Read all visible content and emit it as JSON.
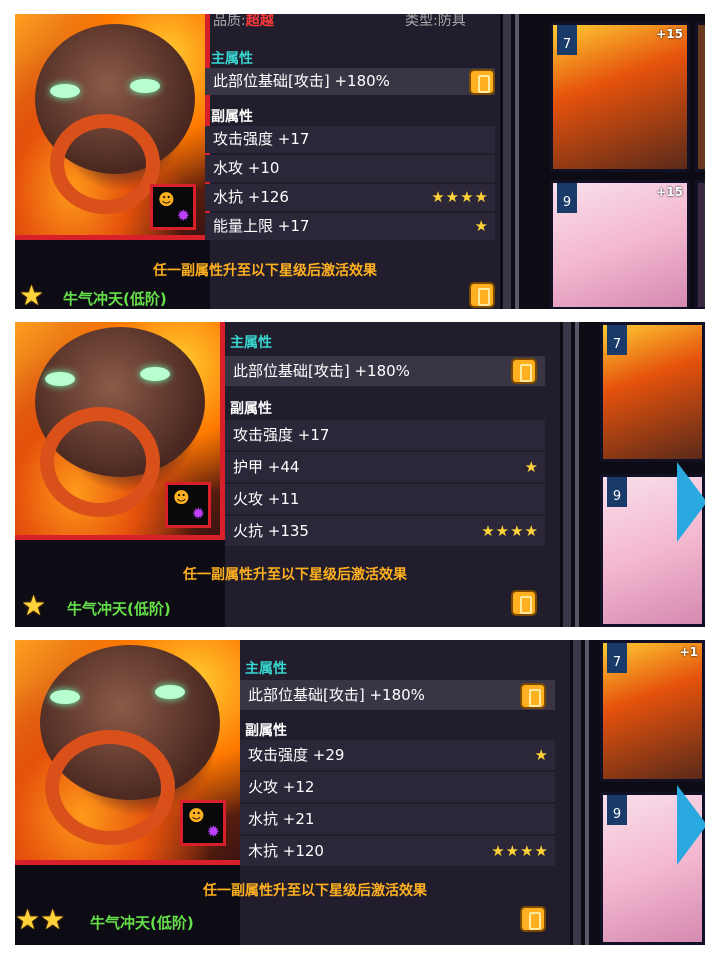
{
  "panels": [
    {
      "quality_label": "品质:",
      "quality_value": "超越",
      "type_label": "类型:",
      "type_value": "防具",
      "main_attr_title": "主属性",
      "main_attr": "此部位基础[攻击] +180%",
      "sub_attr_title": "副属性",
      "sub_attrs": [
        {
          "text": "攻击强度 +17",
          "stars": ""
        },
        {
          "text": "水攻 +10",
          "stars": ""
        },
        {
          "text": "水抗 +126",
          "stars": "★★★★"
        },
        {
          "text": "能量上限 +17",
          "stars": "★"
        }
      ],
      "hint": "任一副属性升至以下星级后激活效果",
      "set_name": "牛气冲天(低阶)",
      "set_stars": "★",
      "cards": [
        {
          "level": "7",
          "plus": "+15"
        },
        {
          "level": "9",
          "plus": "+15"
        }
      ]
    },
    {
      "main_attr_title": "主属性",
      "main_attr": "此部位基础[攻击] +180%",
      "sub_attr_title": "副属性",
      "sub_attrs": [
        {
          "text": "攻击强度 +17",
          "stars": ""
        },
        {
          "text": "护甲 +44",
          "stars": "★"
        },
        {
          "text": "火攻 +11",
          "stars": ""
        },
        {
          "text": "火抗 +135",
          "stars": "★★★★"
        }
      ],
      "hint": "任一副属性升至以下星级后激活效果",
      "set_name": "牛气冲天(低阶)",
      "set_stars": "★",
      "cards": [
        {
          "level": "7",
          "plus": ""
        },
        {
          "level": "9",
          "plus": ""
        }
      ]
    },
    {
      "main_attr_title": "主属性",
      "main_attr": "此部位基础[攻击] +180%",
      "sub_attr_title": "副属性",
      "sub_attrs": [
        {
          "text": "攻击强度 +29",
          "stars": "★"
        },
        {
          "text": "火攻 +12",
          "stars": ""
        },
        {
          "text": "水抗 +21",
          "stars": ""
        },
        {
          "text": "木抗 +120",
          "stars": "★★★★"
        }
      ],
      "hint": "任一副属性升至以下星级后激活效果",
      "set_name": "牛气冲天(低阶)",
      "set_stars": "★★",
      "cards": [
        {
          "level": "7",
          "plus": "+1"
        },
        {
          "level": "9",
          "plus": ""
        }
      ]
    }
  ],
  "colors": {
    "accent_cyan": "#39d6d0",
    "quality_red": "#ff3a3a",
    "hint_orange": "#ffb020",
    "set_green": "#66e04a",
    "star_gold": "#ffd23a"
  },
  "icons": [
    "lock-icon",
    "star-icon",
    "skull-icon",
    "gear-icon",
    "scroll-right-arrow-icon"
  ]
}
